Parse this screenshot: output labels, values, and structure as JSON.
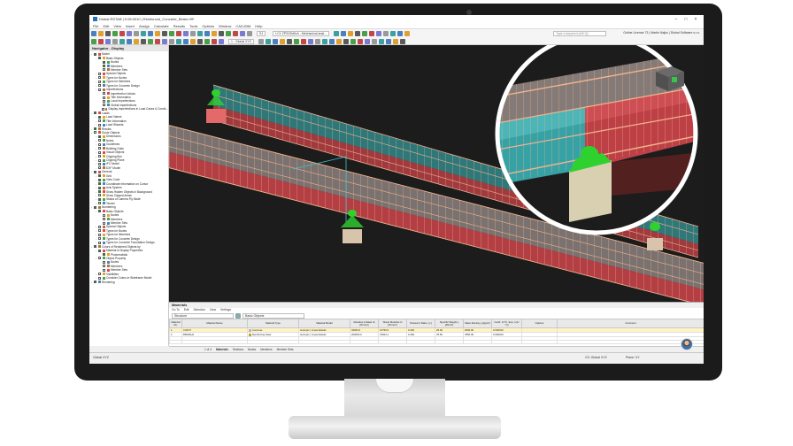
{
  "window": {
    "title": "Dlubal RSTAB | 9.05.0010 | Reinforced_Concrete_Beam.rf9*",
    "controls": [
      "–",
      "□",
      "×"
    ]
  },
  "menu": {
    "items": [
      "File",
      "Edit",
      "View",
      "Insert",
      "Assign",
      "Calculate",
      "Results",
      "Tools",
      "Options",
      "Window",
      "CAD-BIM",
      "Help"
    ],
    "search_placeholder": "Type a keyword (Alt+Q)",
    "license": "Online License 73 | Martin Najko | Dlubal Software s.r.o."
  },
  "toolbar": {
    "load_case": "LC1 ZPS/Oldřích - Mechanical anal...",
    "load_short": "S1",
    "view_mode": "1 - Global XYZ"
  },
  "navigator": {
    "title": "Navigator - Display",
    "items": [
      {
        "label": "Model",
        "level": 0,
        "checked": true
      },
      {
        "label": "Basic Objects",
        "level": 1,
        "checked": true
      },
      {
        "label": "Nodes",
        "level": 2,
        "checked": true
      },
      {
        "label": "Members",
        "level": 2,
        "checked": true
      },
      {
        "label": "Member Sets",
        "level": 2,
        "checked": true
      },
      {
        "label": "Special Objects",
        "level": 1,
        "checked": false
      },
      {
        "label": "Types for Nodes",
        "level": 1,
        "checked": false
      },
      {
        "label": "Types for Members",
        "level": 1,
        "checked": false
      },
      {
        "label": "Types for Concrete Design",
        "level": 1,
        "checked": false
      },
      {
        "label": "Imperfections",
        "level": 1,
        "checked": false
      },
      {
        "label": "Imperfection Values",
        "level": 2,
        "checked": false
      },
      {
        "label": "Title Information",
        "level": 2,
        "checked": false
      },
      {
        "label": "Local Imperfections",
        "level": 2,
        "checked": false
      },
      {
        "label": "Global Imperfections",
        "level": 2,
        "checked": false
      },
      {
        "label": "Display Imperfections in Load Cases & Combi...",
        "level": 2,
        "checked": false
      },
      {
        "label": "Loads",
        "level": 0,
        "checked": true
      },
      {
        "label": "Load Values",
        "level": 1,
        "checked": true
      },
      {
        "label": "Title Information",
        "level": 1,
        "checked": false
      },
      {
        "label": "Load Wizards",
        "level": 1,
        "checked": false
      },
      {
        "label": "Results",
        "level": 0,
        "checked": true
      },
      {
        "label": "Guide Objects",
        "level": 0,
        "checked": true
      },
      {
        "label": "Dimensions",
        "level": 1,
        "checked": true
      },
      {
        "label": "Notes",
        "level": 1,
        "checked": false
      },
      {
        "label": "Guidelines",
        "level": 1,
        "checked": false
      },
      {
        "label": "Building Grids",
        "level": 1,
        "checked": false
      },
      {
        "label": "Visual Objects",
        "level": 1,
        "checked": false
      },
      {
        "label": "Clipping Box",
        "level": 1,
        "checked": false
      },
      {
        "label": "Clipping Plane",
        "level": 1,
        "checked": false
      },
      {
        "label": "IFC Model",
        "level": 1,
        "checked": false
      },
      {
        "label": "DXF Model",
        "level": 1,
        "checked": false
      },
      {
        "label": "General",
        "level": 0,
        "checked": true
      },
      {
        "label": "Grid",
        "level": 1,
        "checked": true
      },
      {
        "label": "View Cube",
        "level": 1,
        "checked": true
      },
      {
        "label": "Coordinate Information on Cursor",
        "level": 1,
        "checked": true
      },
      {
        "label": "Axis System",
        "level": 1,
        "checked": true
      },
      {
        "label": "Show Hidden Objects in Background",
        "level": 1,
        "checked": true
      },
      {
        "label": "Show Clipped Areas",
        "level": 1,
        "checked": true
      },
      {
        "label": "Status of Camera Fly Mode",
        "level": 1,
        "checked": true
      },
      {
        "label": "Terrain",
        "level": 1,
        "checked": true
      },
      {
        "label": "Numbering",
        "level": 0,
        "checked": true
      },
      {
        "label": "Basic Objects",
        "level": 1,
        "checked": true
      },
      {
        "label": "Nodes",
        "level": 2,
        "checked": false
      },
      {
        "label": "Members",
        "level": 2,
        "checked": false
      },
      {
        "label": "Member Sets",
        "level": 2,
        "checked": false
      },
      {
        "label": "Special Objects",
        "level": 1,
        "checked": false
      },
      {
        "label": "Types for Nodes",
        "level": 1,
        "checked": false
      },
      {
        "label": "Types for Members",
        "level": 1,
        "checked": false
      },
      {
        "label": "Types for Concrete Design",
        "level": 1,
        "checked": false
      },
      {
        "label": "Types for Concrete Foundation Design",
        "level": 1,
        "checked": false
      },
      {
        "label": "Colors of Rendered Objects by",
        "level": 0,
        "checked": true
      },
      {
        "label": "Material & Display Properties",
        "level": 1,
        "checked": true
      },
      {
        "label": "Photorealistic",
        "level": 2,
        "checked": true
      },
      {
        "label": "Object Property",
        "level": 1,
        "checked": false
      },
      {
        "label": "Nodes",
        "level": 2,
        "checked": false
      },
      {
        "label": "Members",
        "level": 2,
        "checked": false
      },
      {
        "label": "Member Sets",
        "level": 2,
        "checked": false
      },
      {
        "label": "Visibilities",
        "level": 1,
        "checked": false
      },
      {
        "label": "Consider Colors in Wireframe Model",
        "level": 1,
        "checked": false
      },
      {
        "label": "Rendering",
        "level": 0,
        "checked": true
      }
    ]
  },
  "materials": {
    "title": "Materials",
    "menu": [
      "Go To",
      "Edit",
      "Selection",
      "View",
      "Settings"
    ],
    "filter": "Structure",
    "group": "Basic Objects",
    "columns": [
      "Material No.",
      "Material Name",
      "Material Type",
      "Material Model",
      "Modulus of Elast. E [N/mm²]",
      "Shear Modulus G [N/mm²]",
      "Poisson's Ratio ν [-]",
      "Specific Weight γ [kN/m³]",
      "Mass Density ρ [kg/m³]",
      "Coeff. of Th. Exp. α [1/°C]",
      "Options",
      "Comment"
    ],
    "rows": [
      {
        "no": "1",
        "name": "C30/37",
        "type": "Concrete",
        "type_color": "#b6b6b6",
        "model": "Isotropic | Linear Elastic",
        "e": "33000.0",
        "g": "13750.0",
        "nu": "0.200",
        "gamma": "25.00",
        "rho": "2500.00",
        "alpha": "0.000010",
        "options": "",
        "comment": ""
      },
      {
        "no": "2",
        "name": "B500S(A)",
        "type": "Reinforcing Steel",
        "type_color": "#c8a02a",
        "model": "Isotropic | Linear Elastic",
        "e": "200000.0",
        "g": "76923.1",
        "nu": "0.300",
        "gamma": "78.50",
        "rho": "7850.00",
        "alpha": "0.000010",
        "options": "",
        "comment": ""
      },
      {
        "no": "",
        "name": "",
        "type": "",
        "type_color": "",
        "model": "",
        "e": "",
        "g": "",
        "nu": "",
        "gamma": "",
        "rho": "",
        "alpha": "",
        "options": "",
        "comment": ""
      },
      {
        "no": "",
        "name": "",
        "type": "",
        "type_color": "",
        "model": "",
        "e": "",
        "g": "",
        "nu": "",
        "gamma": "",
        "rho": "",
        "alpha": "",
        "options": "",
        "comment": ""
      }
    ],
    "pager": "1 of 4",
    "tabs": [
      "Materials",
      "Sections",
      "Nodes",
      "Members",
      "Member Sets"
    ]
  },
  "status": {
    "workplane": "Global XYZ",
    "cs": "CS: Global XYZ",
    "plane": "Plane: XY"
  },
  "colors": {
    "concrete_red": "#d9474f",
    "concrete_cyan": "#3fc4c8",
    "support_green": "#2fd12f",
    "viewport_bg": "#1c1c1c",
    "accent_orange": "#f0a060"
  }
}
